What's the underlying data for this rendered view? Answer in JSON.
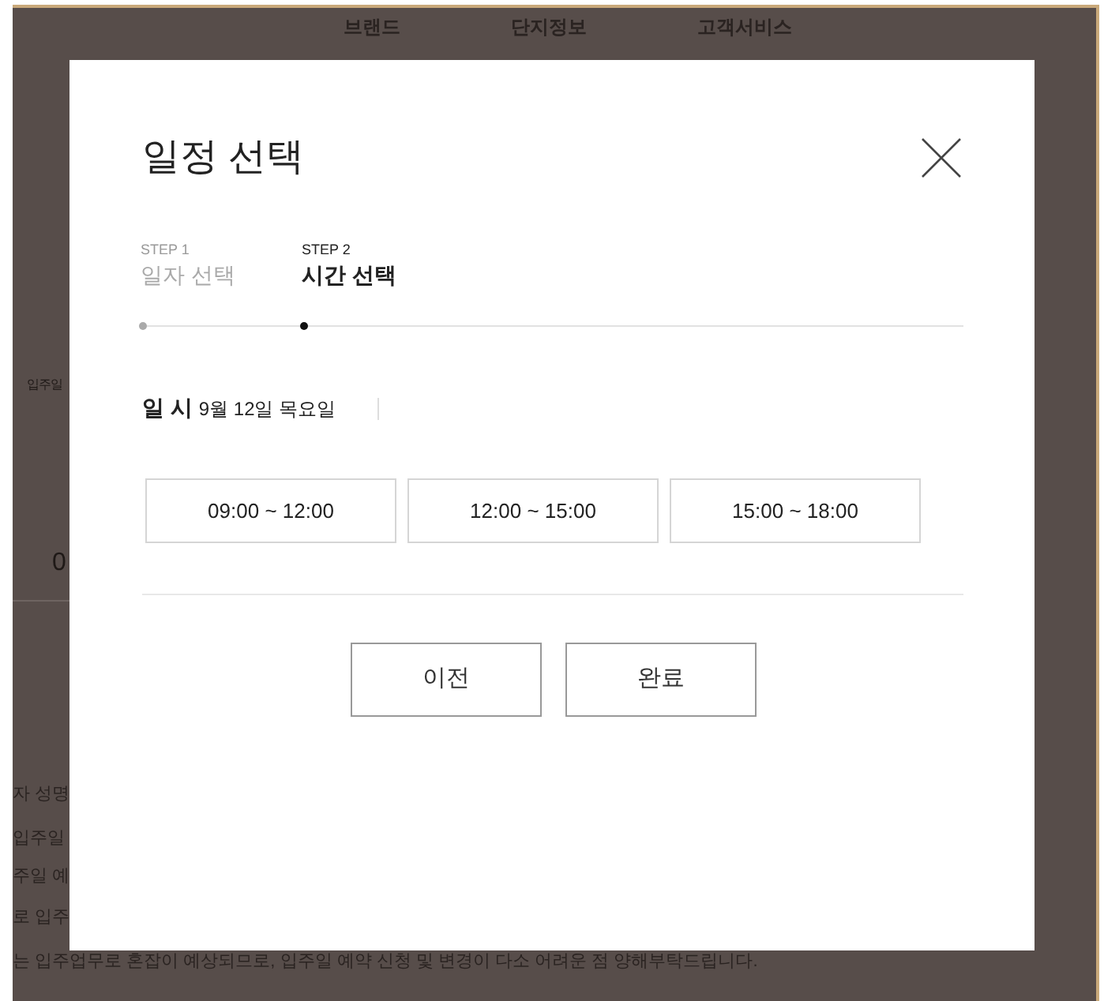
{
  "nav": [
    "브랜드",
    "단지정보",
    "고객서비스"
  ],
  "background_texts": [
    {
      "kind": "small",
      "text": "입주일"
    },
    {
      "kind": "number",
      "text": "0"
    }
  ],
  "background_lines": [
    "자 성명",
    "입주일",
    "주일 예",
    "로 입주",
    "는 입주업무로 혼잡이 예상되므로, 입주일 예약 신청 및 변경이 다소 어려운 점 양해부탁드립니다."
  ],
  "dialog": {
    "title": "일정 선택",
    "steps": [
      {
        "step": "STEP 1",
        "label": "일자 선택",
        "selected": false
      },
      {
        "step": "STEP 2",
        "label": "시간 선택",
        "selected": true
      }
    ],
    "date_label": "일 시",
    "date_value": "9월 12일 목요일",
    "time_slots": [
      {
        "label": "09:00 ~ 12:00",
        "selected": false
      },
      {
        "label": "12:00 ~ 15:00",
        "selected": false
      },
      {
        "label": "15:00 ~ 18:00",
        "selected": false
      }
    ],
    "buttons": [
      "이전",
      "완료"
    ]
  }
}
